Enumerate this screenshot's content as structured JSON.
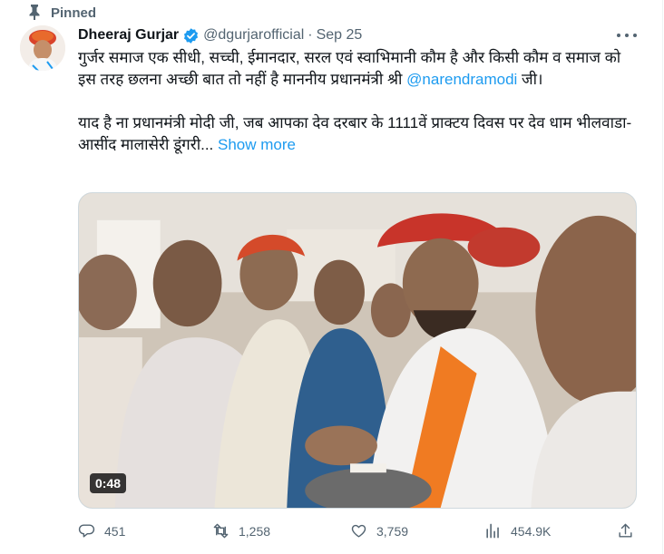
{
  "pinned": {
    "label": "Pinned"
  },
  "tweet": {
    "author_name": "Dheeraj Gurjar",
    "handle": "@dgurjarofficial",
    "separator": "·",
    "date": "Sep 25",
    "text_line1": "गुर्जर समाज एक सीधी, सच्ची, ईमानदार, सरल एवं स्वाभिमानी कौम है और किसी कौम व समाज को इस तरह छलना अच्छी बात तो नहीं है माननीय प्रधानमंत्री श्री ",
    "mention": "@narendramodi",
    "text_line1_end": " जी।",
    "text_line2": "याद है ना प्रधानमंत्री मोदी जी, जब आपका देव दरबार के 1111वें प्राक्टय दिवस पर देव धाम भीलवाडा-आसींद मालासेरी डूंगरी... ",
    "show_more": "Show more",
    "video_duration": "0:48"
  },
  "actions": {
    "replies": "451",
    "retweets": "1,258",
    "likes": "3,759",
    "views": "454.9K"
  },
  "colors": {
    "accent": "#1d9bf0",
    "secondary_text": "#536471",
    "verified": "#1d9bf0"
  },
  "icons": {
    "pin": "pin-icon",
    "verified": "verified-badge-icon",
    "more": "more-dots-icon",
    "reply": "reply-icon",
    "retweet": "retweet-icon",
    "like": "heart-icon",
    "views": "views-chart-icon",
    "share": "share-icon"
  }
}
